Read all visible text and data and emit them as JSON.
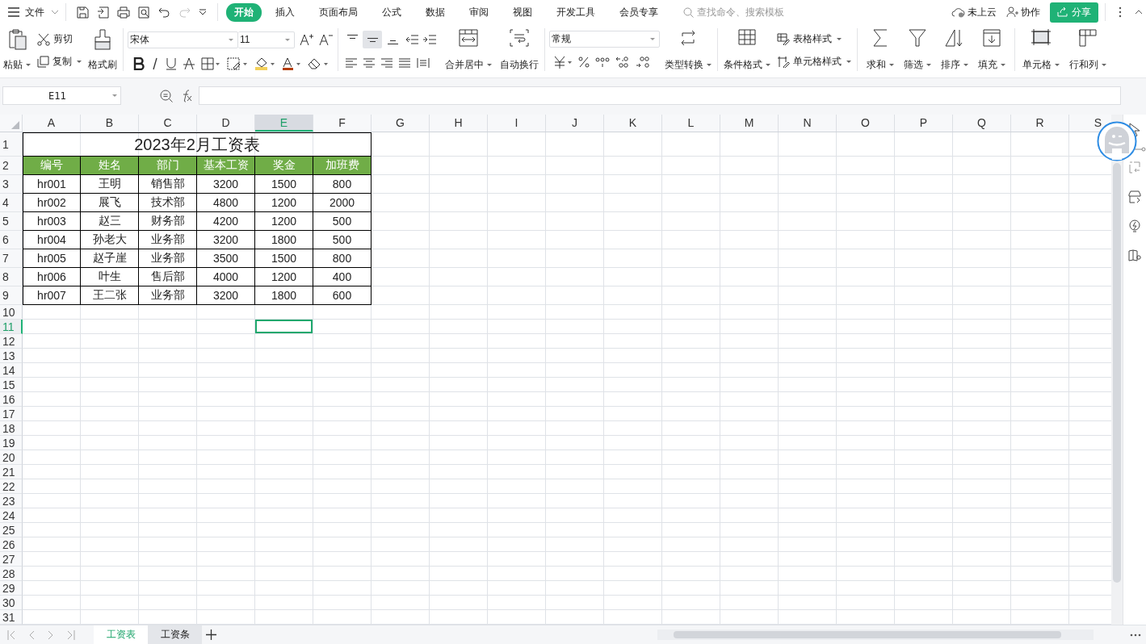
{
  "title_bar": {
    "file_menu": "文件",
    "redo_disabled": true,
    "tabs": [
      {
        "label": "开始",
        "selected": true
      },
      {
        "label": "插入",
        "selected": false
      },
      {
        "label": "页面布局",
        "selected": false
      },
      {
        "label": "公式",
        "selected": false
      },
      {
        "label": "数据",
        "selected": false
      },
      {
        "label": "审阅",
        "selected": false
      },
      {
        "label": "视图",
        "selected": false
      },
      {
        "label": "开发工具",
        "selected": false
      },
      {
        "label": "会员专享",
        "selected": false
      }
    ],
    "search": {
      "placeholder": "查找命令、搜索模板"
    },
    "cloud_status": "未上云",
    "collaborate": "协作",
    "share": "分享"
  },
  "ribbon": {
    "paste": "粘贴",
    "cut": "剪切",
    "copy": "复制",
    "format_painter": "格式刷",
    "font": "宋体",
    "font_size": "11",
    "vertical_align_buttons": [
      {
        "selected": false
      },
      {
        "selected": true
      },
      {
        "selected": false
      }
    ],
    "merge_center": "合并居中",
    "wrap_text": "自动换行",
    "number_format": "常规",
    "convert_type": "类型转换",
    "conditional_format": "条件格式",
    "table_style": "表格样式",
    "cell_style": "单元格样式",
    "sum": "求和",
    "filter": "筛选",
    "sort": "排序",
    "fill": "填充",
    "cells": "单元格",
    "rows_columns": "行和列"
  },
  "formula_bar": {
    "name_box": "E11"
  },
  "sheet": {
    "columns": [
      {
        "label": "A",
        "selected": false
      },
      {
        "label": "B",
        "selected": false
      },
      {
        "label": "C",
        "selected": false
      },
      {
        "label": "D",
        "selected": false
      },
      {
        "label": "E",
        "selected": true
      },
      {
        "label": "F",
        "selected": false
      },
      {
        "label": "G",
        "selected": false
      },
      {
        "label": "H",
        "selected": false
      },
      {
        "label": "I",
        "selected": false
      },
      {
        "label": "J",
        "selected": false
      },
      {
        "label": "K",
        "selected": false
      },
      {
        "label": "L",
        "selected": false
      },
      {
        "label": "M",
        "selected": false
      },
      {
        "label": "N",
        "selected": false
      },
      {
        "label": "O",
        "selected": false
      },
      {
        "label": "P",
        "selected": false
      },
      {
        "label": "Q",
        "selected": false
      },
      {
        "label": "R",
        "selected": false
      },
      {
        "label": "S",
        "selected": false
      }
    ],
    "rows": [
      {
        "label": "1",
        "selected": false
      },
      {
        "label": "2",
        "selected": false
      },
      {
        "label": "3",
        "selected": false
      },
      {
        "label": "4",
        "selected": false
      },
      {
        "label": "5",
        "selected": false
      },
      {
        "label": "6",
        "selected": false
      },
      {
        "label": "7",
        "selected": false
      },
      {
        "label": "8",
        "selected": false
      },
      {
        "label": "9",
        "selected": false
      },
      {
        "label": "10",
        "selected": false
      },
      {
        "label": "11",
        "selected": true
      },
      {
        "label": "12",
        "selected": false
      },
      {
        "label": "13",
        "selected": false
      },
      {
        "label": "14",
        "selected": false
      },
      {
        "label": "15",
        "selected": false
      },
      {
        "label": "16",
        "selected": false
      },
      {
        "label": "17",
        "selected": false
      },
      {
        "label": "18",
        "selected": false
      },
      {
        "label": "19",
        "selected": false
      },
      {
        "label": "20",
        "selected": false
      },
      {
        "label": "21",
        "selected": false
      },
      {
        "label": "22",
        "selected": false
      },
      {
        "label": "23",
        "selected": false
      },
      {
        "label": "24",
        "selected": false
      },
      {
        "label": "25",
        "selected": false
      },
      {
        "label": "26",
        "selected": false
      },
      {
        "label": "27",
        "selected": false
      },
      {
        "label": "28",
        "selected": false
      },
      {
        "label": "29",
        "selected": false
      },
      {
        "label": "30",
        "selected": false
      },
      {
        "label": "31",
        "selected": false
      }
    ],
    "title": "2023年2月工资表",
    "headers": [
      "编号",
      "姓名",
      "部门",
      "基本工资",
      "奖金",
      "加班费"
    ],
    "data": [
      [
        "hr001",
        "王明",
        "销售部",
        "3200",
        "1500",
        "800"
      ],
      [
        "hr002",
        "展飞",
        "技术部",
        "4800",
        "1200",
        "2000"
      ],
      [
        "hr003",
        "赵三",
        "财务部",
        "4200",
        "1200",
        "500"
      ],
      [
        "hr004",
        "孙老大",
        "业务部",
        "3200",
        "1800",
        "500"
      ],
      [
        "hr005",
        "赵子崖",
        "业务部",
        "3500",
        "1500",
        "800"
      ],
      [
        "hr006",
        "叶生",
        "售后部",
        "4000",
        "1200",
        "400"
      ],
      [
        "hr007",
        "王二张",
        "业务部",
        "3200",
        "1800",
        "600"
      ]
    ]
  },
  "sheet_tabs": [
    {
      "label": "工资表",
      "selected": true
    },
    {
      "label": "工资条",
      "selected": false
    }
  ]
}
